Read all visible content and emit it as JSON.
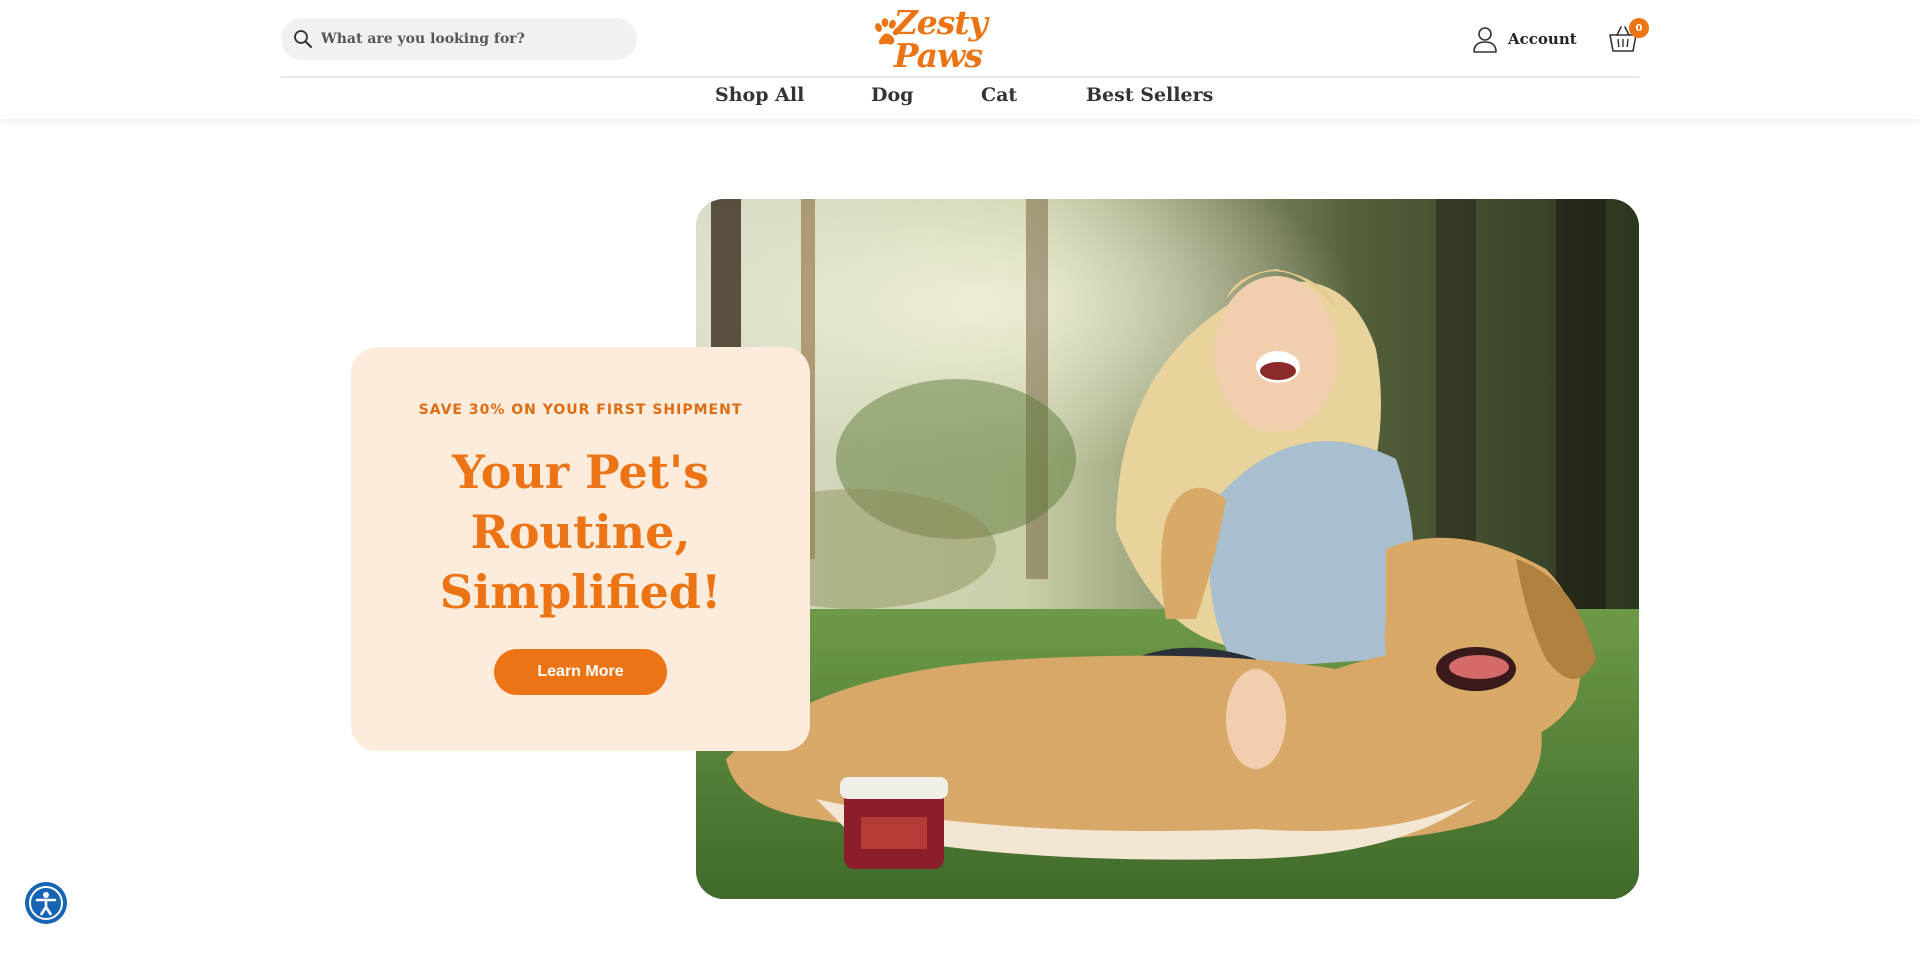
{
  "header": {
    "search": {
      "placeholder": "What are you looking for?",
      "value": ""
    },
    "logo": {
      "text": "Zesty Paws"
    },
    "account_label": "Account",
    "cart_count": "0"
  },
  "nav": {
    "items": [
      {
        "label": "Shop All"
      },
      {
        "label": "Dog"
      },
      {
        "label": "Cat"
      },
      {
        "label": "Best Sellers"
      }
    ]
  },
  "hero": {
    "eyebrow": "SAVE 30% ON YOUR FIRST SHIPMENT",
    "heading": "Your Pet's Routine, Simplified!",
    "button_label": "Learn More",
    "image_alt": "Woman laughing with a dog lying on the grass"
  },
  "colors": {
    "brand_orange": "#ec7415",
    "promo_background": "#fdecdc",
    "accessibility_blue": "#1664b4"
  },
  "icons": [
    "search-icon",
    "paw-icon",
    "user-icon",
    "basket-icon",
    "accessibility-icon"
  ]
}
